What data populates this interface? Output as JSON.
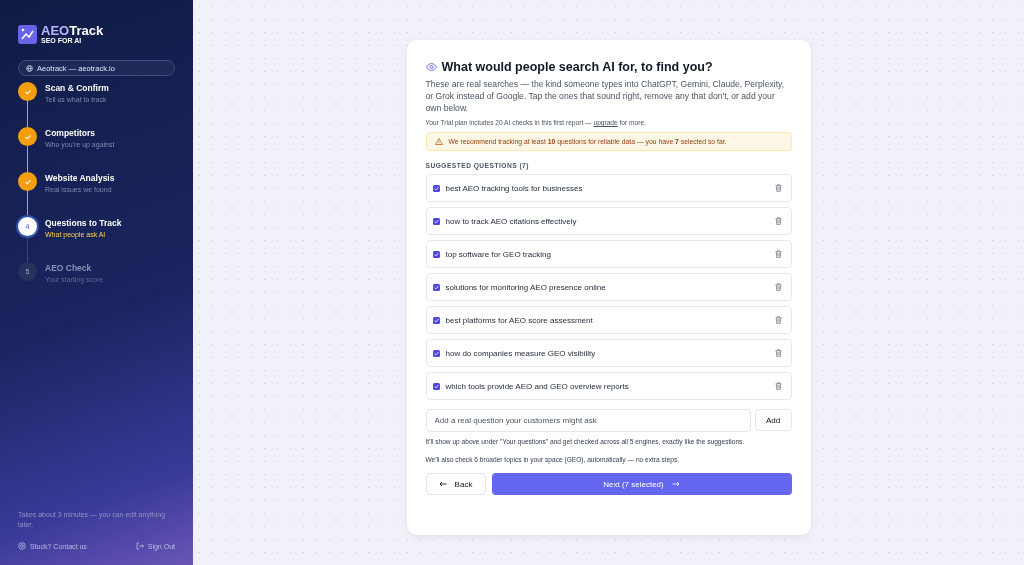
{
  "brand": {
    "name_part1": "AEO",
    "name_part2": "Track",
    "tagline": "SEO FOR AI"
  },
  "site_pill": "Aeotrack — aeotrack.io",
  "steps": [
    {
      "title": "Scan & Confirm",
      "subtitle": "Tell us what to track",
      "completed": true,
      "selected": false
    },
    {
      "title": "Competitors",
      "subtitle": "Who you're up against",
      "completed": true,
      "selected": false
    },
    {
      "title": "Website Analysis",
      "subtitle": "Real issues we found",
      "completed": true,
      "selected": false
    },
    {
      "number": "4",
      "title": "Questions to Track",
      "subtitle": "What people ask AI",
      "completed": false,
      "selected": true
    },
    {
      "number": "5",
      "title": "AEO Check",
      "subtitle": "Your starting score",
      "completed": false,
      "selected": false
    }
  ],
  "sidebar_note": "Takes about 3 minutes — you can edit anything later.",
  "sidebar_links": {
    "contact": "Stuck? Contact us",
    "sign_out": "Sign Out"
  },
  "card": {
    "title": "What would people search AI for, to find you?",
    "description": "These are real searches — the kind someone types into ChatGPT, Gemini, Claude, Perplexity, or Grok instead of Google. Tap the ones that sound right, remove any that don't, or add your own below.",
    "plan_text_before": "Your Trial plan includes 20 AI checks in this first report — ",
    "plan_link": "upgrade",
    "plan_text_after": " for more.",
    "warning": "We recommend tracking at least **10** questions for reliable data — you have **7** selected so far.",
    "section_label": "SUGGESTED QUESTIONS (7)",
    "questions": [
      {
        "text": "best AEO tracking tools for businesses",
        "checked": true
      },
      {
        "text": "how to track AEO citations effectively",
        "checked": true
      },
      {
        "text": "top software for GEO tracking",
        "checked": true
      },
      {
        "text": "solutions for monitoring AEO presence online",
        "checked": true
      },
      {
        "text": "best platforms for AEO score assessment",
        "checked": true
      },
      {
        "text": "how do companies measure GEO visibility",
        "checked": true
      },
      {
        "text": "which tools provide AEO and GEO overview reports",
        "checked": true
      }
    ],
    "add_field": {
      "placeholder": "Add a real question your customers might ask"
    },
    "add_button": "Add",
    "helper": "It'll show up above under \"Your questions\" and get checked across all 5 engines, exactly like the suggestions.",
    "geo_note": "We'll also check 6 broader topics in your space (GEO), automatically — no extra steps.",
    "back_button": "Back",
    "next_button": "Next (7 selected)"
  }
}
